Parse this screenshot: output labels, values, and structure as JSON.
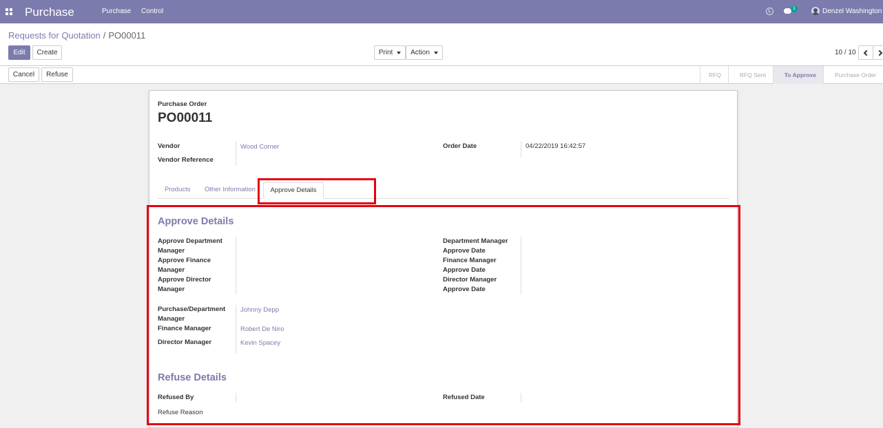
{
  "navbar": {
    "brand": "Purchase",
    "menu": [
      "Purchase",
      "Control"
    ],
    "chat_badge": "1",
    "user_name": "Denzel Washington"
  },
  "control_panel": {
    "breadcrumb_parent": "Requests for Quotation",
    "breadcrumb_separator": "/",
    "breadcrumb_current": "PO00011",
    "edit_label": "Edit",
    "create_label": "Create",
    "print_label": "Print",
    "action_label": "Action",
    "pager_value": "10 / 10"
  },
  "statusbar": {
    "cancel_label": "Cancel",
    "refuse_label": "Refuse",
    "stages": [
      "RFQ",
      "RFQ Sent",
      "To Approve",
      "Purchase Order"
    ],
    "active_stage": "To Approve"
  },
  "form": {
    "doc_type": "Purchase Order",
    "doc_name": "PO00011",
    "vendor_label": "Vendor",
    "vendor_value": "Wood Corner",
    "vendor_ref_label": "Vendor Reference",
    "order_date_label": "Order Date",
    "order_date_value": "04/22/2019 16:42:57",
    "tabs": [
      "Products",
      "Other Information",
      "Approve Details"
    ],
    "active_tab": "Approve Details"
  },
  "approve_details": {
    "title": "Approve Details",
    "left_labels": [
      "Approve Department",
      "Manager",
      "Approve Finance",
      "Manager",
      "Approve Director",
      "Manager"
    ],
    "right_labels": [
      "Department Manager",
      "Approve Date",
      "Finance Manager",
      "Approve Date",
      "Director Manager",
      "Approve Date"
    ],
    "purchase_dept_label_1": "Purchase/Department",
    "purchase_dept_label_2": "Manager",
    "purchase_dept_value": "Johnny Depp",
    "finance_manager_label": "Finance Manager",
    "finance_manager_value": "Robert De Niro",
    "director_manager_label": "Director Manager",
    "director_manager_value": "Kevin Spacey"
  },
  "refuse_details": {
    "title": "Refuse Details",
    "refused_by_label": "Refused By",
    "refused_date_label": "Refused Date",
    "refuse_reason_label": "Refuse Reason"
  },
  "highlight_color": "#e4000f",
  "accent_color": "#7c7bad"
}
